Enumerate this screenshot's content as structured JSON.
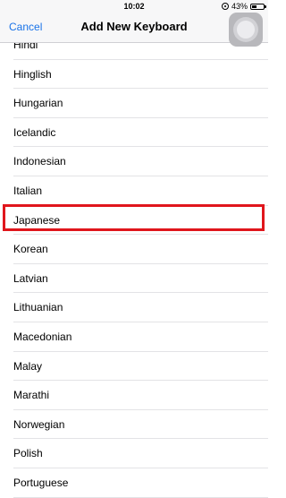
{
  "status_bar": {
    "time": "10:02",
    "battery_percent": "43%",
    "battery_level": 0.43
  },
  "nav": {
    "cancel_label": "Cancel",
    "title": "Add New Keyboard"
  },
  "languages": [
    "Hindi",
    "Hinglish",
    "Hungarian",
    "Icelandic",
    "Indonesian",
    "Italian",
    "Japanese",
    "Korean",
    "Latvian",
    "Lithuanian",
    "Macedonian",
    "Malay",
    "Marathi",
    "Norwegian",
    "Polish",
    "Portuguese"
  ],
  "highlighted_language": "Japanese",
  "colors": {
    "accent": "#1a73e8",
    "highlight": "#e0161c"
  }
}
